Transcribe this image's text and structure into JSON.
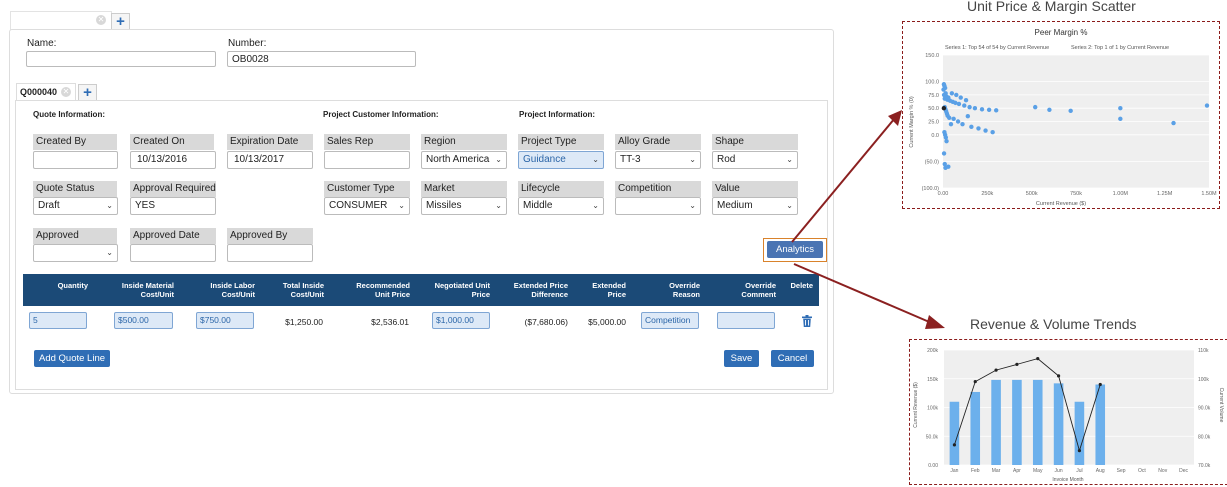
{
  "form": {
    "name_label": "Name:",
    "name_value": "",
    "number_label": "Number:",
    "number_value": "OB0028",
    "quote_tab": "Q000040",
    "sections": {
      "quote": "Quote Information:",
      "customer": "Project Customer Information:",
      "project": "Project Information:"
    },
    "fields": {
      "created_by": {
        "label": "Created By",
        "value": ""
      },
      "created_on": {
        "label": "Created On",
        "value": "10/13/2016"
      },
      "expiration": {
        "label": "Expiration Date",
        "value": "10/13/2017"
      },
      "sales_rep": {
        "label": "Sales Rep",
        "value": ""
      },
      "region": {
        "label": "Region",
        "value": "North America"
      },
      "project_type": {
        "label": "Project Type",
        "value": "Guidance"
      },
      "alloy": {
        "label": "Alloy Grade",
        "value": "TT-3"
      },
      "shape": {
        "label": "Shape",
        "value": "Rod"
      },
      "quote_status": {
        "label": "Quote Status",
        "value": "Draft"
      },
      "approval_required": {
        "label": "Approval Required",
        "value": "YES"
      },
      "customer_type": {
        "label": "Customer Type",
        "value": "CONSUMER"
      },
      "market": {
        "label": "Market",
        "value": "Missiles"
      },
      "lifecycle": {
        "label": "Lifecycle",
        "value": "Middle"
      },
      "competition": {
        "label": "Competition",
        "value": ""
      },
      "value": {
        "label": "Value",
        "value": "Medium"
      },
      "approved": {
        "label": "Approved",
        "value": ""
      },
      "approved_date": {
        "label": "Approved Date",
        "value": ""
      },
      "approved_by": {
        "label": "Approved By",
        "value": ""
      }
    },
    "analytics_button": "Analytics"
  },
  "table": {
    "headers": [
      {
        "l1": "Quantity",
        "l2": ""
      },
      {
        "l1": "Inside Material",
        "l2": "Cost/Unit"
      },
      {
        "l1": "Inside Labor",
        "l2": "Cost/Unit"
      },
      {
        "l1": "Total Inside",
        "l2": "Cost/Unit"
      },
      {
        "l1": "Recommended",
        "l2": "Unit Price"
      },
      {
        "l1": "Negotiated Unit",
        "l2": "Price"
      },
      {
        "l1": "Extended Price",
        "l2": "Difference"
      },
      {
        "l1": "Extended",
        "l2": "Price"
      },
      {
        "l1": "Override",
        "l2": "Reason"
      },
      {
        "l1": "Override",
        "l2": "Comment"
      },
      {
        "l1": "Delete",
        "l2": ""
      }
    ],
    "row": {
      "quantity": "5",
      "material": "$500.00",
      "labor": "$750.00",
      "total": "$1,250.00",
      "recommended": "$2,536.01",
      "negotiated": "$1,000.00",
      "difference": "($7,680.06)",
      "extended": "$5,000.00",
      "reason": "Competition",
      "comment": ""
    },
    "add_line": "Add Quote Line",
    "save": "Save",
    "cancel": "Cancel"
  },
  "scatter": {
    "header": "Unit Price & Margin Scatter",
    "chart_data": {
      "type": "scatter",
      "title": "Peer Margin %",
      "subtitle_s1": "Series 1: Top 54 of 54 by Current Revenue",
      "subtitle_s2": "Series 2: Top 1 of 1 by Current Revenue",
      "xlabel": "Current Revenue ($)",
      "ylabel": "Current Margin % (0)",
      "xlim": [
        0,
        1500000
      ],
      "ylim": [
        -100,
        150
      ],
      "xticks": [
        "0.00",
        "250k",
        "500k",
        "750k",
        "1.00M",
        "1.25M",
        "1.50M"
      ],
      "yticks": [
        "150.0",
        "100.0",
        "75.0",
        "50.0",
        "25.0",
        "0.0",
        "(50.0)",
        "(100.0)"
      ],
      "series": [
        {
          "name": "Series 1",
          "color": "#5aa0e6",
          "points": [
            [
              5000,
              95
            ],
            [
              8000,
              92
            ],
            [
              12000,
              88
            ],
            [
              3000,
              85
            ],
            [
              15000,
              78
            ],
            [
              6000,
              75
            ],
            [
              20000,
              72
            ],
            [
              30000,
              70
            ],
            [
              10000,
              68
            ],
            [
              25000,
              66
            ],
            [
              40000,
              64
            ],
            [
              55000,
              62
            ],
            [
              70000,
              60
            ],
            [
              90000,
              58
            ],
            [
              120000,
              55
            ],
            [
              150000,
              52
            ],
            [
              180000,
              50
            ],
            [
              220000,
              48
            ],
            [
              260000,
              47
            ],
            [
              300000,
              46
            ],
            [
              10000,
              52
            ],
            [
              14000,
              48
            ],
            [
              18000,
              44
            ],
            [
              22000,
              40
            ],
            [
              26000,
              36
            ],
            [
              35000,
              32
            ],
            [
              60000,
              30
            ],
            [
              85000,
              25
            ],
            [
              110000,
              20
            ],
            [
              160000,
              15
            ],
            [
              200000,
              12
            ],
            [
              240000,
              8
            ],
            [
              280000,
              5
            ],
            [
              8000,
              5
            ],
            [
              12000,
              0
            ],
            [
              16000,
              -5
            ],
            [
              20000,
              -12
            ],
            [
              6000,
              -35
            ],
            [
              10000,
              -55
            ],
            [
              14000,
              -62
            ],
            [
              30000,
              -60
            ],
            [
              50000,
              78
            ],
            [
              75000,
              75
            ],
            [
              100000,
              70
            ],
            [
              130000,
              65
            ],
            [
              520000,
              52
            ],
            [
              600000,
              47
            ],
            [
              720000,
              45
            ],
            [
              1000000,
              50
            ],
            [
              1000000,
              30
            ],
            [
              1300000,
              22
            ],
            [
              1580000,
              55
            ],
            [
              45000,
              20
            ],
            [
              140000,
              35
            ]
          ]
        },
        {
          "name": "Series 2",
          "color": "#222222",
          "points": [
            [
              5000,
              50
            ]
          ]
        }
      ]
    }
  },
  "trends": {
    "header": "Revenue & Volume Trends",
    "chart_data": {
      "type": "bar",
      "categories": [
        "Jan",
        "Feb",
        "Mar",
        "Apr",
        "May",
        "Jun",
        "Jul",
        "Aug",
        "Sep",
        "Oct",
        "Nov",
        "Dec"
      ],
      "xlabel": "Invoice Month",
      "ylabel": "Current Revenue ($)",
      "y2label": "Current Volume",
      "ylim": [
        0,
        200000
      ],
      "y2lim": [
        70000,
        110000
      ],
      "yticks": [
        "200k",
        "150k",
        "100k",
        "50.0k",
        "0.00"
      ],
      "y2ticks": [
        "110k",
        "100k",
        "90.0k",
        "80.0k",
        "70.0k"
      ],
      "series": [
        {
          "name": "Revenue",
          "type": "bar",
          "color": "#6cb0ec",
          "values": [
            110000,
            127000,
            148000,
            148000,
            148000,
            142000,
            110000,
            140000,
            null,
            null,
            null,
            null
          ]
        },
        {
          "name": "Volume",
          "type": "line",
          "color": "#222222",
          "values": [
            77000,
            99000,
            103000,
            105000,
            107000,
            101000,
            75000,
            98000,
            null,
            null,
            null,
            null
          ]
        }
      ]
    }
  }
}
